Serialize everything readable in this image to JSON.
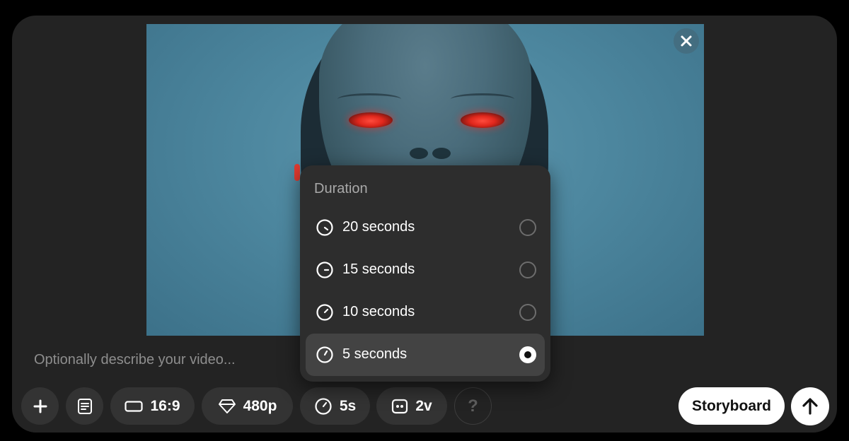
{
  "preview": {
    "close_icon": "close-icon"
  },
  "prompt": {
    "placeholder": "Optionally describe your video..."
  },
  "toolbar": {
    "add_icon": "plus-icon",
    "preset_icon": "preset-list-icon",
    "aspect_ratio": "16:9",
    "resolution": "480p",
    "duration": "5s",
    "variations": "2v",
    "help_label": "?",
    "storyboard_label": "Storyboard",
    "submit_icon": "arrow-up-icon"
  },
  "duration_menu": {
    "title": "Duration",
    "options": [
      {
        "label": "20 seconds",
        "selected": false
      },
      {
        "label": "15 seconds",
        "selected": false
      },
      {
        "label": "10 seconds",
        "selected": false
      },
      {
        "label": "5 seconds",
        "selected": true
      }
    ]
  }
}
